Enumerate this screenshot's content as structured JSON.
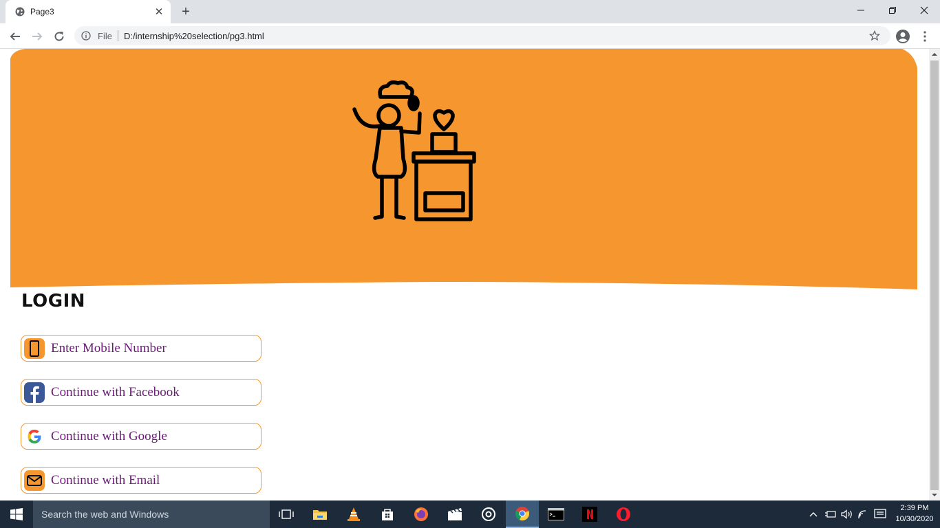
{
  "browser": {
    "tab_title": "Page3",
    "tab_close_glyph": "✕",
    "new_tab_glyph": "+",
    "omnibox_scheme": "File",
    "omnibox_url": "D:/internship%20selection/pg3.html"
  },
  "page": {
    "hero_color": "#f5962f",
    "login_heading": "LOGIN",
    "login_options": [
      {
        "label": "Enter Mobile Number",
        "icon": "mobile-phone-icon"
      },
      {
        "label": "Continue with Facebook",
        "icon": "facebook-icon"
      },
      {
        "label": "Continue with Google",
        "icon": "google-icon"
      },
      {
        "label": "Continue with Email",
        "icon": "email-icon"
      }
    ]
  },
  "taskbar": {
    "search_placeholder": "Search the web and Windows",
    "clock_time": "2:39 PM",
    "clock_date": "10/30/2020"
  }
}
